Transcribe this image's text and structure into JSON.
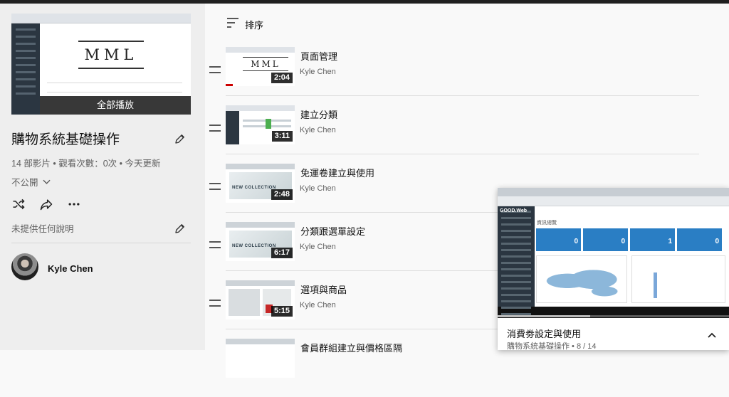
{
  "playlist": {
    "play_all_label": "全部播放",
    "title": "購物系統基礎操作",
    "stats": "14 部影片 • 觀看次數：0次 • 今天更新",
    "privacy": "不公開",
    "description": "未提供任何說明",
    "owner": "Kyle Chen",
    "hero_thumb_text": "MML"
  },
  "sort": {
    "label": "排序"
  },
  "videos": [
    {
      "title": "頁面管理",
      "channel": "Kyle Chen",
      "duration": "2:04",
      "thumb_text": "MML"
    },
    {
      "title": "建立分類",
      "channel": "Kyle Chen",
      "duration": "3:11"
    },
    {
      "title": "免運卷建立與使用",
      "channel": "Kyle Chen",
      "duration": "2:48",
      "thumb_text": "NEW COLLECTION"
    },
    {
      "title": "分類跟選單設定",
      "channel": "Kyle Chen",
      "duration": "6:17",
      "thumb_text": "NEW COLLECTION"
    },
    {
      "title": "選項與商品",
      "channel": "Kyle Chen",
      "duration": "5:15"
    },
    {
      "title": "會員群組建立與價格區隔",
      "channel": "",
      "duration": ""
    }
  ],
  "miniplayer": {
    "title": "消費劵設定與使用",
    "subtitle": "購物系統基礎操作 • 8 / 14",
    "screen": {
      "logo": "GOOD.Web",
      "panel_title": "資訊總覽",
      "cards": [
        "0",
        "0",
        "1",
        "0"
      ]
    }
  },
  "icons": [
    "pencil-icon",
    "shuffle-icon",
    "share-icon",
    "more-icon",
    "sort-icon",
    "drag-handle-icon",
    "chevron-down-icon",
    "chevron-up-icon"
  ],
  "colors": {
    "accent_red": "#cc0000",
    "page_bg": "#f9f9f9",
    "sidebar_bg": "#eeeeee"
  }
}
